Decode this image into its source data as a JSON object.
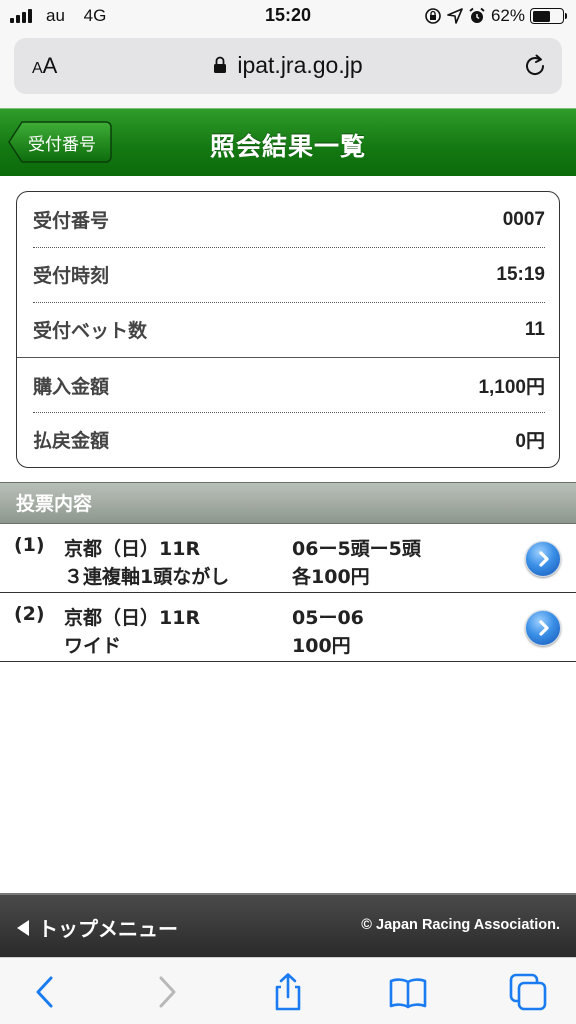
{
  "status_bar": {
    "carrier": "au",
    "network": "4G",
    "time": "15:20",
    "battery_percent": "62%",
    "battery_level": 0.62
  },
  "browser": {
    "text_size_label_small": "A",
    "text_size_label_big": "A",
    "url": "ipat.jra.go.jp"
  },
  "header": {
    "back_label": "受付番号",
    "title": "照会結果一覧"
  },
  "info": {
    "rows": [
      {
        "label": "受付番号",
        "value": "0007"
      },
      {
        "label": "受付時刻",
        "value": "15:19"
      },
      {
        "label": "受付ベット数",
        "value": "11"
      },
      {
        "label": "購入金額",
        "value": "1,100円"
      },
      {
        "label": "払戻金額",
        "value": "0円"
      }
    ]
  },
  "section": {
    "title": "投票内容"
  },
  "bets": [
    {
      "index": "(1)",
      "race": "京都（日）11R",
      "type": "３連複軸1頭ながし",
      "combination": "06ー5頭ー5頭",
      "amount": "各100円"
    },
    {
      "index": "(2)",
      "race": "京都（日）11R",
      "type": "ワイド",
      "combination": "05ー06",
      "amount": "100円"
    }
  ],
  "footer": {
    "top_menu_label": "トップメニュー",
    "copyright": "© Japan Racing Association."
  },
  "colors": {
    "header_green": "#157a13",
    "link_blue": "#1a7cf0"
  }
}
